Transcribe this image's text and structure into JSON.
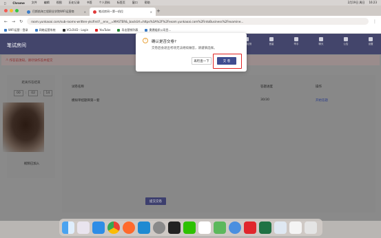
{
  "menubar": {
    "app": "Chrome",
    "items": [
      "文件",
      "编辑",
      "视图",
      "历史记录",
      "书签",
      "个人资料",
      "标签页",
      "窗口",
      "帮助"
    ],
    "right": [
      "2月19日 周日",
      "16:23"
    ]
  },
  "tabs": [
    {
      "label": "巴斯航海工程职业学院WIFI运营商",
      "favicon_color": "#3b7cc7"
    },
    {
      "label": "笔试房间—第一机位",
      "favicon_color": "#e03a3a"
    }
  ],
  "new_tab": "+",
  "address": {
    "url": "room.yunkaoai.com/sub-rooms-written-ykcfirst?__env__=MASTER&_backUrl=https%3A%2F%2Fexam.yunkaoai.com%2FintoBusiness%2Fexamine..."
  },
  "bookmarks": [
    {
      "label": "WIFI运营｜登录",
      "color": "#3b7cc7"
    },
    {
      "label": "网络运营系统",
      "color": "#3b7cc7"
    },
    {
      "label": "VCLOUD - Login",
      "color": "#333333"
    },
    {
      "label": "YouTube",
      "color": "#e02020"
    },
    {
      "label": "导出营销列表",
      "color": "#2a8a3a"
    },
    {
      "label": "奥德组织公司目...",
      "color": "#3b7cc7"
    }
  ],
  "app": {
    "title": "笔试房间",
    "header_icons": [
      {
        "label": "设备检测",
        "icon": "monitor-icon"
      },
      {
        "label": "音量",
        "icon": "speaker-icon"
      },
      {
        "label": "举手",
        "icon": "hand-icon"
      },
      {
        "label": "聊天",
        "icon": "chat-icon"
      },
      {
        "label": "公告",
        "icon": "notice-icon"
      },
      {
        "label": "设置",
        "icon": "gear-icon"
      }
    ],
    "alert": "作答前须知，请尽快作答并提交",
    "left_panel": {
      "title": "距离作答结束",
      "timer": [
        "00",
        "02",
        "14"
      ],
      "hint": "作答时间已到达时候",
      "camera_label": "视频已加入"
    },
    "table": {
      "headers": [
        "试卷名称",
        "答题进度",
        "操作"
      ],
      "rows": [
        {
          "name": "模拟单招题目第一套",
          "progress": "30/30",
          "action": "开始答题"
        }
      ]
    },
    "submit_label": "提交交卷"
  },
  "modal": {
    "title": "确认是否交卷?",
    "text": "交卷后会退出考场无法继续做答，请谨慎选择。",
    "cancel_label": "再检查一下",
    "ok_label": "交 卷",
    "highlight_color": "#e02020"
  }
}
